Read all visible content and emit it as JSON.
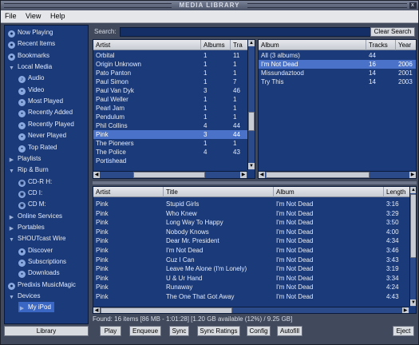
{
  "window": {
    "title": "MEDIA LIBRARY",
    "close_glyph": "x"
  },
  "menu": [
    "File",
    "View",
    "Help"
  ],
  "sidebar": [
    {
      "label": "Now Playing",
      "icon": "now-playing-icon",
      "glyph": "●",
      "kind": "round"
    },
    {
      "label": "Recent Items",
      "icon": "recent-items-icon",
      "glyph": "●",
      "kind": "round"
    },
    {
      "label": "Bookmarks",
      "icon": "bookmarks-icon",
      "glyph": "●",
      "kind": "round"
    },
    {
      "label": "Local Media",
      "icon": "expanded-triangle-icon",
      "glyph": "▼",
      "kind": "tri"
    },
    {
      "label": "Audio",
      "icon": "audio-icon",
      "glyph": "♪",
      "kind": "round"
    },
    {
      "label": "Video",
      "icon": "video-icon",
      "glyph": "▪",
      "kind": "round"
    },
    {
      "label": "Most Played",
      "icon": "playlist-icon",
      "glyph": "▪",
      "kind": "round"
    },
    {
      "label": "Recently Added",
      "icon": "playlist-icon",
      "glyph": "▪",
      "kind": "round"
    },
    {
      "label": "Recently Played",
      "icon": "playlist-icon",
      "glyph": "▪",
      "kind": "round"
    },
    {
      "label": "Never Played",
      "icon": "playlist-icon",
      "glyph": "▪",
      "kind": "round"
    },
    {
      "label": "Top Rated",
      "icon": "playlist-icon",
      "glyph": "▪",
      "kind": "round"
    },
    {
      "label": "Playlists",
      "icon": "collapsed-triangle-icon",
      "glyph": "▶",
      "kind": "tri"
    },
    {
      "label": "Rip & Burn",
      "icon": "expanded-triangle-icon",
      "glyph": "▼",
      "kind": "tri"
    },
    {
      "label": "CD-R H:",
      "icon": "cd-icon",
      "glyph": "◉",
      "kind": "round"
    },
    {
      "label": "CD I:",
      "icon": "cd-icon",
      "glyph": "◉",
      "kind": "round"
    },
    {
      "label": "CD M:",
      "icon": "cd-icon",
      "glyph": "◉",
      "kind": "round"
    },
    {
      "label": "Online Services",
      "icon": "collapsed-triangle-icon",
      "glyph": "▶",
      "kind": "tri"
    },
    {
      "label": "Portables",
      "icon": "collapsed-triangle-icon",
      "glyph": "▶",
      "kind": "tri"
    },
    {
      "label": "SHOUTcast Wire",
      "icon": "expanded-triangle-icon",
      "glyph": "▼",
      "kind": "tri"
    },
    {
      "label": "Discover",
      "icon": "discover-icon",
      "glyph": "●",
      "kind": "round"
    },
    {
      "label": "Subscriptions",
      "icon": "subscriptions-icon",
      "glyph": "▪",
      "kind": "round"
    },
    {
      "label": "Downloads",
      "icon": "downloads-icon",
      "glyph": "▪",
      "kind": "round"
    },
    {
      "label": "Predixis MusicMagic",
      "icon": "musicmagic-icon",
      "glyph": "●",
      "kind": "round"
    },
    {
      "label": "Devices",
      "icon": "expanded-triangle-icon",
      "glyph": "▼",
      "kind": "tri"
    },
    {
      "label": "My iPod",
      "icon": "ipod-icon",
      "glyph": "▶",
      "kind": "tri",
      "selected": true
    }
  ],
  "library_button": "Library",
  "search": {
    "label": "Search:",
    "value": "",
    "clear_label": "Clear Search"
  },
  "artists": {
    "columns": [
      "Artist",
      "Albums",
      "Tra"
    ],
    "rows": [
      [
        "Orbital",
        "1",
        "11"
      ],
      [
        "Origin Unknown",
        "1",
        "1"
      ],
      [
        "Pato Panton",
        "1",
        "1"
      ],
      [
        "Paul Simon",
        "1",
        "7"
      ],
      [
        "Paul Van Dyk",
        "3",
        "46"
      ],
      [
        "Paul Weller",
        "1",
        "1"
      ],
      [
        "Pearl Jam",
        "1",
        "1"
      ],
      [
        "Pendulum",
        "1",
        "1"
      ],
      [
        "Phil Collins",
        "4",
        "44"
      ],
      [
        "Pink",
        "3",
        "44"
      ],
      [
        "The Pioneers",
        "1",
        "1"
      ],
      [
        "The Police",
        "4",
        "43"
      ],
      [
        "Portishead",
        "",
        ""
      ]
    ],
    "selected_index": 9
  },
  "albums": {
    "columns": [
      "Album",
      "Tracks",
      "Year"
    ],
    "rows": [
      [
        "All (3 albums)",
        "44",
        ""
      ],
      [
        "I'm Not Dead",
        "16",
        "2006"
      ],
      [
        "Missundaztood",
        "14",
        "2001"
      ],
      [
        "Try This",
        "14",
        "2003"
      ]
    ],
    "selected_index": 1
  },
  "tracks": {
    "columns": [
      "Artist",
      "Title",
      "Album",
      "Length"
    ],
    "rows": [
      [
        "Pink",
        "Stupid Girls",
        "I'm Not Dead",
        "3:16"
      ],
      [
        "Pink",
        "Who Knew",
        "I'm Not Dead",
        "3:29"
      ],
      [
        "Pink",
        "Long Way To Happy",
        "I'm Not Dead",
        "3:50"
      ],
      [
        "Pink",
        "Nobody Knows",
        "I'm Not Dead",
        "4:00"
      ],
      [
        "Pink",
        "Dear Mr. President",
        "I'm Not Dead",
        "4:34"
      ],
      [
        "Pink",
        "I'm Not Dead",
        "I'm Not Dead",
        "3:46"
      ],
      [
        "Pink",
        "Cuz I Can",
        "I'm Not Dead",
        "3:43"
      ],
      [
        "Pink",
        "Leave Me Alone (I'm Lonely)",
        "I'm Not Dead",
        "3:19"
      ],
      [
        "Pink",
        "U & Ur Hand",
        "I'm Not Dead",
        "3:34"
      ],
      [
        "Pink",
        "Runaway",
        "I'm Not Dead",
        "4:24"
      ],
      [
        "Pink",
        "The One That Got Away",
        "I'm Not Dead",
        "4:43"
      ]
    ]
  },
  "status": "Found: 16 items [86 MB - 1:01:28] [1.20 GB available (12%) / 9.25 GB]",
  "buttons": {
    "play": "Play",
    "enqueue": "Enqueue",
    "sync": "Sync",
    "sync_ratings": "Sync Ratings",
    "config": "Config",
    "autofill": "Autofill",
    "eject": "Eject"
  },
  "scroll_glyphs": {
    "up": "▲",
    "down": "▼",
    "left": "◀",
    "right": "▶",
    "grip": "⁞"
  }
}
